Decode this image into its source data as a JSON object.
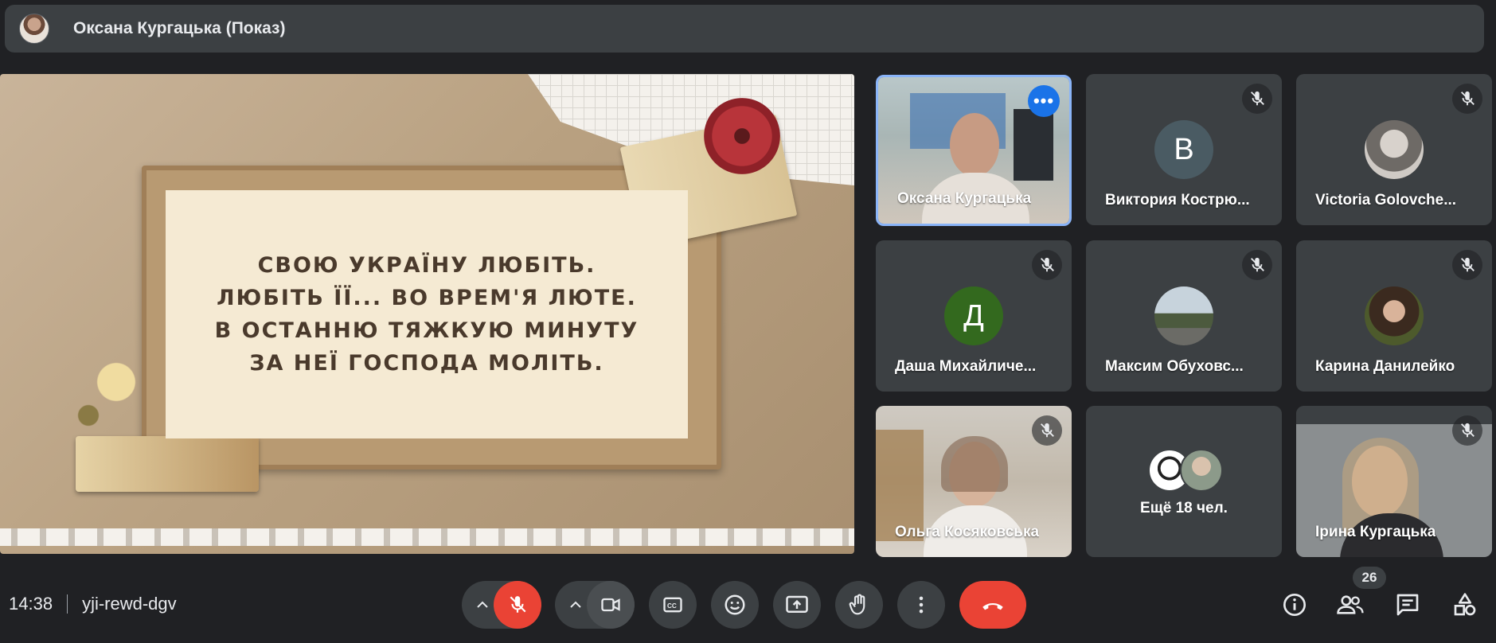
{
  "header": {
    "presenter_title": "Оксана Кургацька (Показ)",
    "avatar_icon": "presenter-avatar"
  },
  "presentation": {
    "quote_lines": [
      "СВОЮ УКРАЇНУ ЛЮБІТЬ.",
      "ЛЮБІТЬ ЇЇ... ВО ВРЕМ'Я ЛЮТЕ.",
      "В ОСТАННЮ ТЯЖКУЮ МИНУТУ",
      "ЗА НЕЇ ГОСПОДА МОЛІТЬ."
    ]
  },
  "participants": [
    {
      "name": "Оксана Кургацька",
      "type": "video",
      "active": true
    },
    {
      "name": "Виктория Кострю...",
      "type": "letter",
      "letter": "В",
      "color": "#4a5b63"
    },
    {
      "name": "Victoria Golovche...",
      "type": "photo"
    },
    {
      "name": "Даша Михайличе...",
      "type": "letter",
      "letter": "Д",
      "color": "#33691e"
    },
    {
      "name": "Максим Обуховс...",
      "type": "photo"
    },
    {
      "name": "Карина Данилейко",
      "type": "photo"
    },
    {
      "name": "Ольга Косяковська",
      "type": "video"
    },
    {
      "name": "Ещё 18 чел.",
      "type": "more"
    },
    {
      "name": "Ірина Кургацька",
      "type": "video"
    }
  ],
  "bottombar": {
    "time": "14:38",
    "meeting_code": "yji-rewd-dgv",
    "people_count": "26"
  },
  "colors": {
    "background": "#202124",
    "tile": "#3c4043",
    "accent": "#8ab4f8",
    "danger": "#ea4335"
  }
}
